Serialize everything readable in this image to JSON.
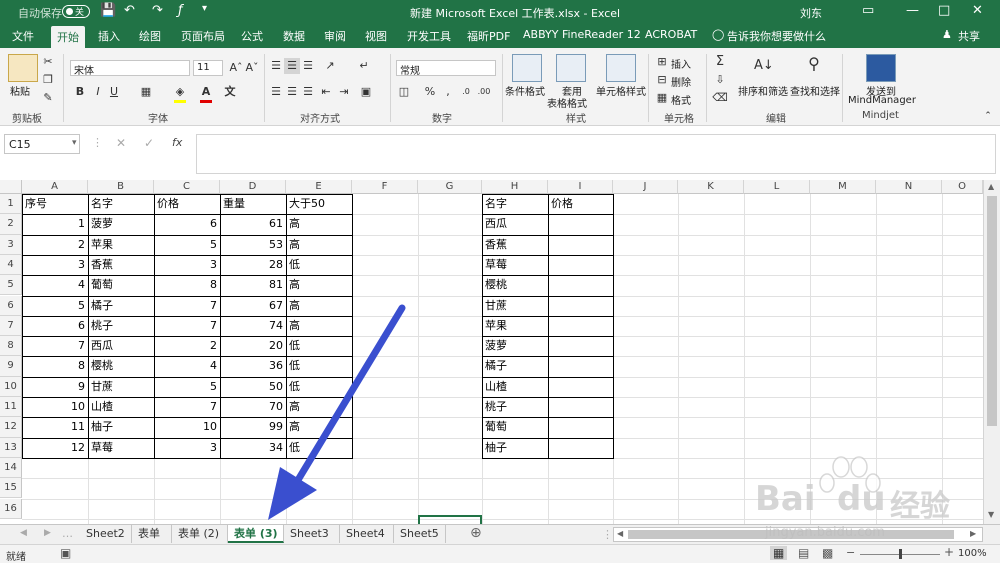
{
  "titlebar": {
    "autosave_label": "自动保存",
    "autosave_state": "关",
    "title": "新建 Microsoft Excel 工作表.xlsx - Excel",
    "user": "刘东"
  },
  "ribbon_tabs": [
    "文件",
    "开始",
    "插入",
    "绘图",
    "页面布局",
    "公式",
    "数据",
    "审阅",
    "视图",
    "开发工具",
    "福昕PDF",
    "ABBYY FineReader 12",
    "ACROBAT"
  ],
  "active_tab": "开始",
  "tell_me": "告诉我你想要做什么",
  "share_label": "共享",
  "ribbon": {
    "paste_label": "粘贴",
    "clipboard_label": "剪贴板",
    "font_name": "宋体",
    "font_size": "11",
    "bold": "B",
    "italic": "I",
    "underline": "U",
    "font_group_label": "字体",
    "align_group_label": "对齐方式",
    "number_format": "常规",
    "number_group_label": "数字",
    "cond_format": "条件格式",
    "table_format_1": "套用",
    "table_format_2": "表格格式",
    "cell_styles": "单元格样式",
    "styles_group_label": "样式",
    "insert": "插入",
    "delete": "删除",
    "format": "格式",
    "cells_group_label": "单元格",
    "sort_filter": "排序和筛选",
    "find_select": "查找和选择",
    "editing_group_label": "编辑",
    "mindjet_1": "发送到",
    "mindjet_2": "MindManager",
    "mindjet_group_label": "Mindjet",
    "colors": {
      "font_red": "#e00000",
      "highlight_yellow": "#ffff00"
    }
  },
  "formula_bar": {
    "name_box": "C15",
    "fx": "fx",
    "value": ""
  },
  "columns": [
    "A",
    "B",
    "C",
    "D",
    "E",
    "F",
    "G",
    "H",
    "I",
    "J",
    "K",
    "L",
    "M",
    "N",
    "O"
  ],
  "rows": [
    "1",
    "2",
    "3",
    "4",
    "5",
    "6",
    "7",
    "8",
    "9",
    "10",
    "11",
    "12",
    "13",
    "14",
    "15",
    "16"
  ],
  "table1": {
    "headers": [
      "序号",
      "名字",
      "价格",
      "重量",
      "大于50"
    ],
    "rows": [
      [
        "1",
        "菠萝",
        "6",
        "61",
        "高"
      ],
      [
        "2",
        "苹果",
        "5",
        "53",
        "高"
      ],
      [
        "3",
        "香蕉",
        "3",
        "28",
        "低"
      ],
      [
        "4",
        "葡萄",
        "8",
        "81",
        "高"
      ],
      [
        "5",
        "橘子",
        "7",
        "67",
        "高"
      ],
      [
        "6",
        "桃子",
        "7",
        "74",
        "高"
      ],
      [
        "7",
        "西瓜",
        "2",
        "20",
        "低"
      ],
      [
        "8",
        "樱桃",
        "4",
        "36",
        "低"
      ],
      [
        "9",
        "甘蔗",
        "5",
        "50",
        "低"
      ],
      [
        "10",
        "山楂",
        "7",
        "70",
        "高"
      ],
      [
        "11",
        "柚子",
        "10",
        "99",
        "高"
      ],
      [
        "12",
        "草莓",
        "3",
        "34",
        "低"
      ]
    ]
  },
  "table2": {
    "headers": [
      "名字",
      "价格"
    ],
    "names": [
      "西瓜",
      "香蕉",
      "草莓",
      "樱桃",
      "甘蔗",
      "苹果",
      "菠萝",
      "橘子",
      "山楂",
      "桃子",
      "葡萄",
      "柚子"
    ]
  },
  "sheets": [
    "Sheet2",
    "表单",
    "表单 (2)",
    "表单 (3)",
    "Sheet3",
    "Sheet4",
    "Sheet5"
  ],
  "active_sheet": "表单 (3)",
  "status": {
    "ready": "就绪",
    "zoom": "100%"
  },
  "annotation_color": "#3a4fcf",
  "watermark": {
    "brand": "Bai",
    "brand2": "du",
    "cn": "经验",
    "url": "jingyan.baidu.com"
  }
}
